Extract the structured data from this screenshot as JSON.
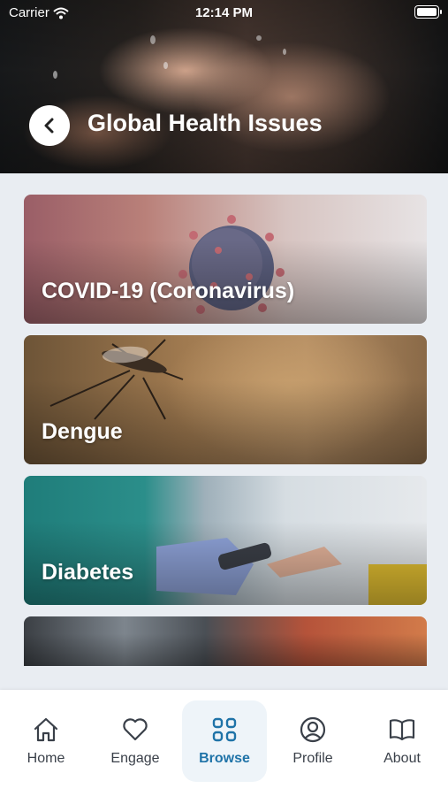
{
  "status_bar": {
    "carrier": "Carrier",
    "time": "12:14 PM"
  },
  "header": {
    "title": "Global Health Issues",
    "back_icon": "chevron-left-icon"
  },
  "cards": [
    {
      "label": "COVID-19 (Coronavirus)"
    },
    {
      "label": "Dengue"
    },
    {
      "label": "Diabetes"
    },
    {
      "label": ""
    }
  ],
  "tabs": [
    {
      "label": "Home",
      "icon": "home-icon",
      "active": false
    },
    {
      "label": "Engage",
      "icon": "heart-icon",
      "active": false
    },
    {
      "label": "Browse",
      "icon": "grid-icon",
      "active": true
    },
    {
      "label": "Profile",
      "icon": "user-circle-icon",
      "active": false
    },
    {
      "label": "About",
      "icon": "book-icon",
      "active": false
    }
  ],
  "colors": {
    "accent": "#1f73a8",
    "tab_text": "#3a4049",
    "background": "#e9edf2"
  }
}
